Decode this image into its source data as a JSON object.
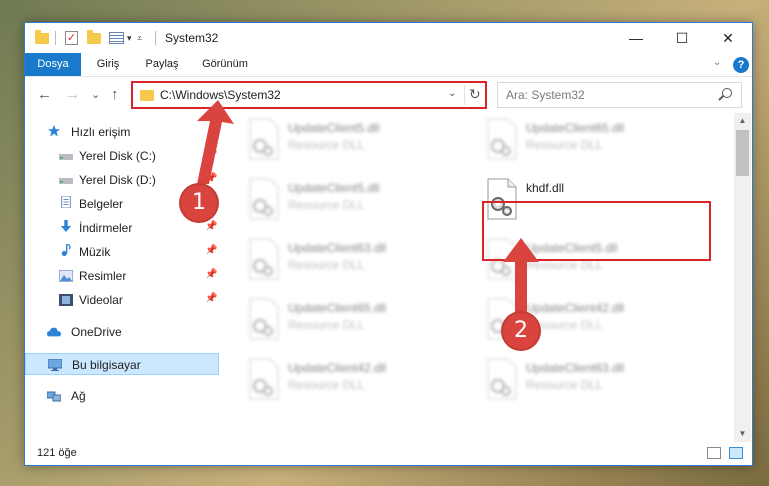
{
  "window": {
    "title": "System32",
    "minimize": "—",
    "maximize": "☐",
    "close": "✕"
  },
  "ribbon": {
    "tabs": [
      "Dosya",
      "Giriş",
      "Paylaş",
      "Görünüm"
    ],
    "help": "?"
  },
  "nav": {
    "back": "←",
    "forward": "→",
    "recent": "⌄",
    "up": "↑"
  },
  "address": {
    "path": "C:\\Windows\\System32",
    "dropdown": "⌄",
    "refresh": "↻"
  },
  "search": {
    "placeholder": "Ara: System32"
  },
  "sidebar": {
    "items": [
      {
        "label": "Hızlı erişim",
        "icon": "star-icon",
        "pinned": false
      },
      {
        "label": "Yerel Disk (C:)",
        "icon": "drive-icon",
        "pinned": true
      },
      {
        "label": "Yerel Disk (D:)",
        "icon": "drive-icon",
        "pinned": true
      },
      {
        "label": "Belgeler",
        "icon": "documents-icon",
        "pinned": true
      },
      {
        "label": "İndirmeler",
        "icon": "downloads-icon",
        "pinned": true
      },
      {
        "label": "Müzik",
        "icon": "music-icon",
        "pinned": true
      },
      {
        "label": "Resimler",
        "icon": "pictures-icon",
        "pinned": true
      },
      {
        "label": "Videolar",
        "icon": "videos-icon",
        "pinned": true
      },
      {
        "label": "OneDrive",
        "icon": "onedrive-icon",
        "pinned": false
      },
      {
        "label": "Bu bilgisayar",
        "icon": "computer-icon",
        "pinned": false,
        "selected": true
      },
      {
        "label": "Ağ",
        "icon": "network-icon",
        "pinned": false
      }
    ]
  },
  "files": [
    {
      "name": "UpdateClient5.dll",
      "type": "Resource DLL",
      "blurred": true
    },
    {
      "name": "UpdateClient65.dll",
      "type": "Resource DLL",
      "blurred": true
    },
    {
      "name": "UpdateClient5.dll",
      "type": "Resource DLL",
      "blurred": true
    },
    {
      "name": "khdf.dll",
      "type": "",
      "blurred": false,
      "highlighted": true
    },
    {
      "name": "UpdateClient63.dll",
      "type": "Resource DLL",
      "blurred": true
    },
    {
      "name": "UpdateClient5.dll",
      "type": "Resource DLL",
      "blurred": true
    },
    {
      "name": "UpdateClient65.dll",
      "type": "Resource DLL",
      "blurred": true
    },
    {
      "name": "UpdateClient42.dll",
      "type": "Resource DLL",
      "blurred": true
    },
    {
      "name": "UpdateClient42.dll",
      "type": "Resource DLL",
      "blurred": true
    },
    {
      "name": "UpdateClient63.dll",
      "type": "Resource DLL",
      "blurred": true
    }
  ],
  "status": {
    "count": "121 öğe"
  },
  "callouts": {
    "one": "1",
    "two": "2"
  },
  "colors": {
    "accent": "#1979ca",
    "highlight": "#d9242b",
    "callout": "#d9453e",
    "selection": "#cce8ff"
  }
}
